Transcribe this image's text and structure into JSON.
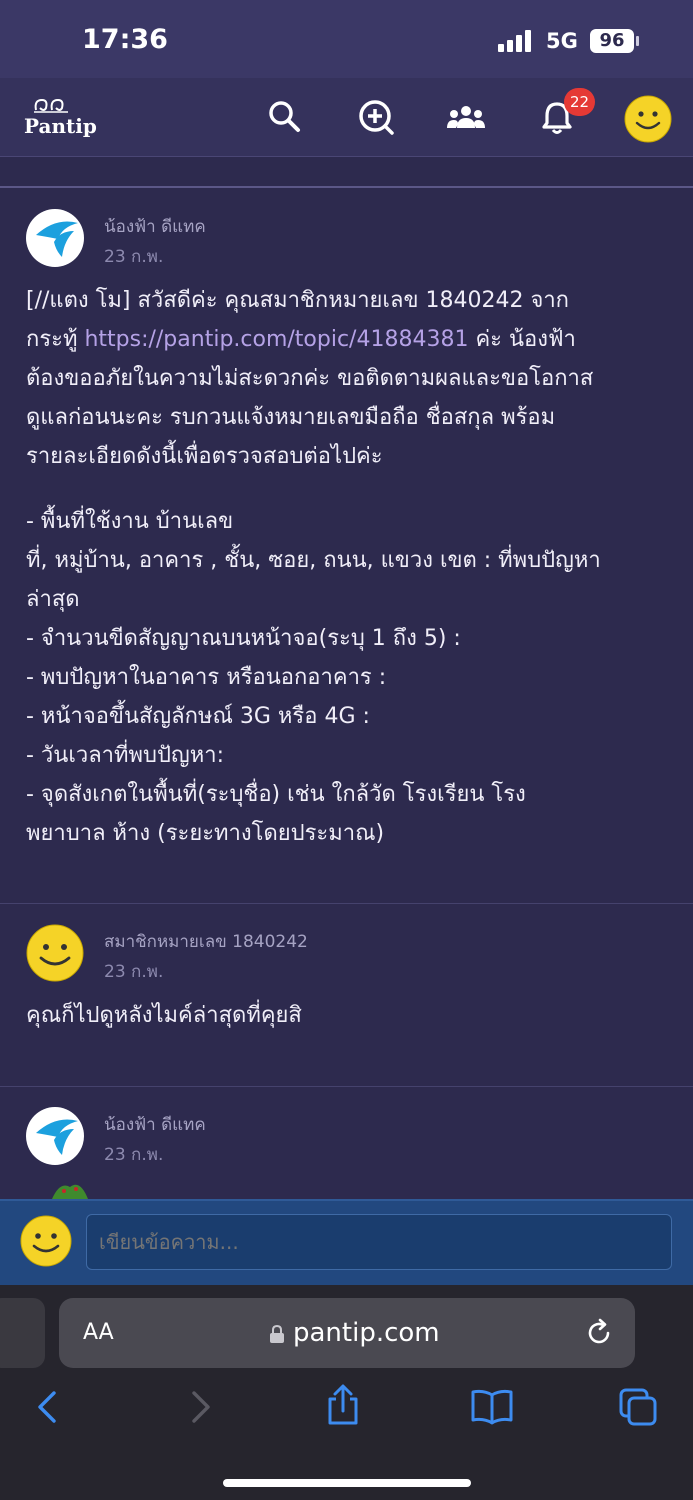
{
  "status": {
    "time": "17:36",
    "network": "5G",
    "battery": "96"
  },
  "header": {
    "logo": "Pantip",
    "notification_count": "22",
    "icons": [
      "search-icon",
      "add-topic-icon",
      "community-icon",
      "bell-icon",
      "smiley-avatar-icon"
    ]
  },
  "comments": [
    {
      "author": "น้องฟ้า ดีแทค",
      "date": "23 ก.พ.",
      "body_pre": "[//แตง โม] สวัสดีค่ะ คุณสมาชิกหมายเลข 1840242  จาก",
      "body_pre2": "กระทู้  ",
      "link": "https://pantip.com/topic/41884381",
      "body_post": "  ค่ะ  น้องฟ้า",
      "body_lines": [
        "ต้องขออภัยในความไม่สะดวกค่ะ ขอติดตามผลและขอโอกาส",
        "ดูแลก่อนนะคะ  รบกวนแจ้งหมายเลขมือถือ   ชื่อสกุล  พร้อม",
        "รายละเอียดดังนี้เพื่อตรวจสอบต่อไปค่ะ"
      ],
      "list_lines": [
        "- พื้นที่ใช้งาน บ้านเลข",
        "ที่, หมู่บ้าน, อาคาร , ชั้น, ซอย, ถนน, แขวง เขต  : ที่พบปัญหา",
        "ล่าสุด",
        "- จำนวนขีดสัญญาณบนหน้าจอ(ระบุ 1 ถึง 5) :",
        "- พบปัญหาในอาคาร หรือนอกอาคาร :",
        "- หน้าจอขึ้นสัญลักษณ์ 3G หรือ 4G :",
        "- วันเวลาที่พบปัญหา:",
        "- จุดสังเกตในพื้นที่(ระบุชื่อ) เช่น ใกล้วัด  โรงเรียน  โรง",
        "พยาบาล ห้าง (ระยะทางโดยประมาณ)"
      ]
    },
    {
      "author": "สมาชิกหมายเลข 1840242",
      "date": "23 ก.พ.",
      "body": "คุณก็ไปดูหลังไมค์ล่าสุดที่คุยสิ"
    },
    {
      "author": "น้องฟ้า ดีแทค",
      "date": "23 ก.พ."
    }
  ],
  "composer": {
    "placeholder": "เขียนข้อความ..."
  },
  "browser": {
    "aa_label": "AA",
    "url": "pantip.com"
  },
  "colors": {
    "page_bg": "#2d2a4e",
    "header_bg": "#35325c",
    "composer_bg": "#22487f",
    "link": "#b5a2e6",
    "badge": "#e53935"
  }
}
